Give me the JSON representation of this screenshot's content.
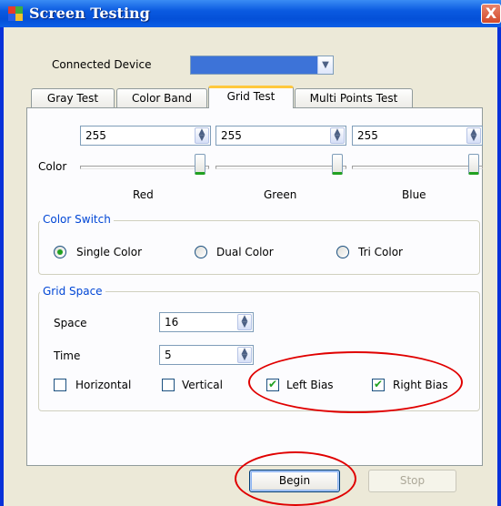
{
  "window": {
    "title": "Screen Testing",
    "close_label": "X"
  },
  "device": {
    "label": "Connected Device",
    "selected": ""
  },
  "tabs": [
    {
      "label": "Gray Test",
      "active": false
    },
    {
      "label": "Color Band",
      "active": false
    },
    {
      "label": "Grid Test",
      "active": true
    },
    {
      "label": "Multi Points Test",
      "active": false
    }
  ],
  "color": {
    "label": "Color",
    "channels": [
      {
        "name": "Red",
        "value": "255"
      },
      {
        "name": "Green",
        "value": "255"
      },
      {
        "name": "Blue",
        "value": "255"
      }
    ]
  },
  "color_switch": {
    "title": "Color Switch",
    "options": [
      {
        "label": "Single Color",
        "checked": true
      },
      {
        "label": "Dual Color",
        "checked": false
      },
      {
        "label": "Tri Color",
        "checked": false
      }
    ]
  },
  "grid_space": {
    "title": "Grid Space",
    "space_label": "Space",
    "space_value": "16",
    "time_label": "Time",
    "time_value": "5",
    "checks": [
      {
        "label": "Horizontal",
        "checked": false
      },
      {
        "label": "Vertical",
        "checked": false
      },
      {
        "label": "Left Bias",
        "checked": true
      },
      {
        "label": "Right Bias",
        "checked": true
      }
    ]
  },
  "actions": {
    "begin_label": "Begin",
    "stop_label": "Stop"
  },
  "colors": {
    "title_bar": "#0a5ae0",
    "accent_green": "#21a121",
    "annotation": "#e00000",
    "group_title": "#0046d5"
  }
}
